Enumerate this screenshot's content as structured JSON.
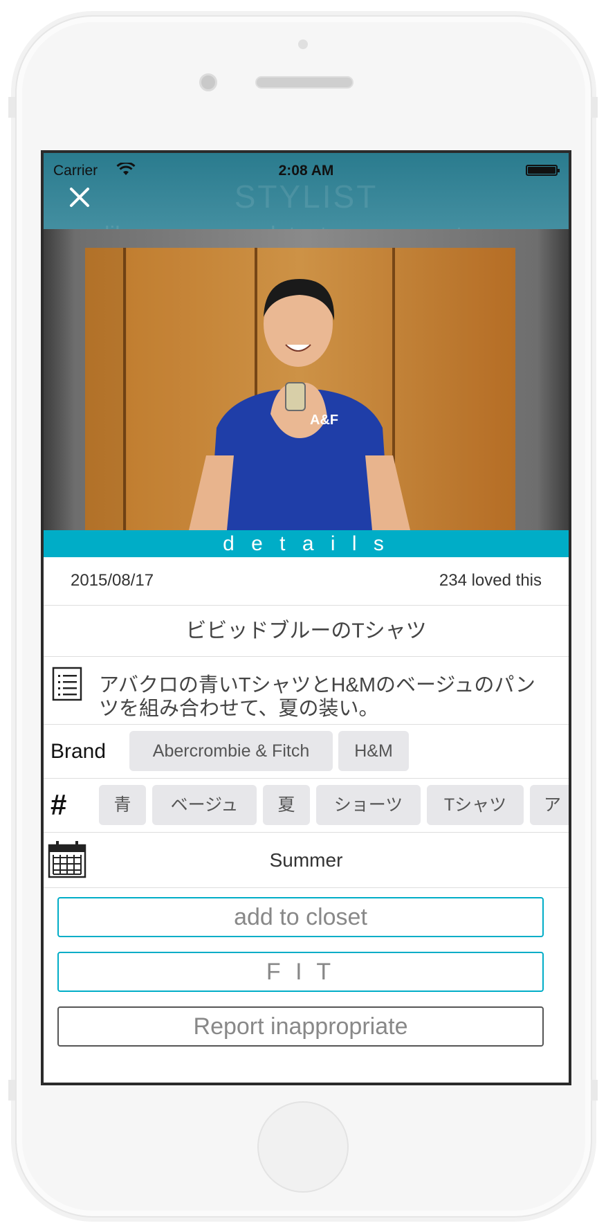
{
  "status_bar": {
    "carrier": "Carrier",
    "time": "2:08 AM"
  },
  "background_header": {
    "title": "STYLIST",
    "tabs": [
      "like",
      "latest",
      "tag"
    ]
  },
  "details": {
    "section_label": "d e t a i l s",
    "date": "2015/08/17",
    "loves": "234 loved this",
    "title": "ビビッドブルーのTシャツ",
    "description": "アバクロの青いTシャツとH&Mのベージュのパンツを組み合わせて、夏の装い。",
    "brand_label": "Brand",
    "brands": [
      "Abercrombie & Fitch",
      "H&M"
    ],
    "tag_label": "#",
    "tags": [
      "青",
      "ベージュ",
      "夏",
      "ショーツ",
      "Tシャツ",
      "ア"
    ],
    "season": "Summer"
  },
  "buttons": {
    "add_to_closet": "add to closet",
    "fit": "F I T",
    "report": "Report inappropriate"
  },
  "colors": {
    "accent": "#00adc7",
    "header": "#2a7b8e",
    "chip_bg": "#e7e7ea"
  }
}
